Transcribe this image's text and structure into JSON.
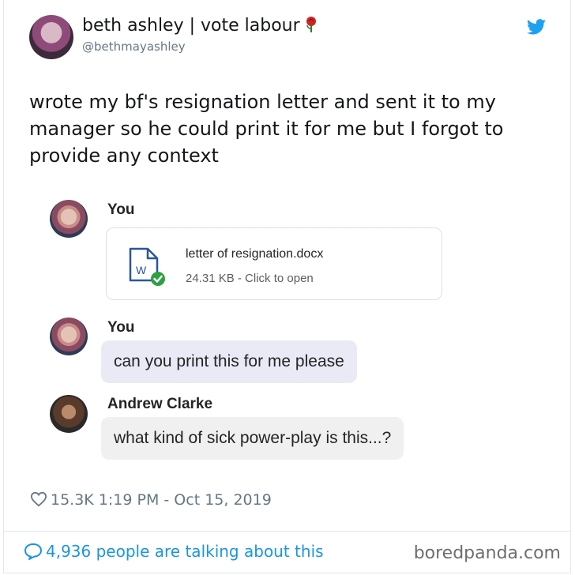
{
  "tweet": {
    "author_name": "beth ashley | vote labour",
    "author_handle": "@bethmayashley",
    "text": "wrote my bf's resignation letter and sent it to my manager so he could print it for me but I forgot to provide any context",
    "likes": "15.3K",
    "timestamp": "1:19 PM - Oct 15, 2019",
    "talking_about": "4,936 people are talking about this",
    "icons": [
      "rose-icon",
      "twitter-bird-icon",
      "heart-icon",
      "speech-bubble-icon"
    ],
    "accent_color": "#1b95e0"
  },
  "chat": {
    "messages": [
      {
        "sender": "You",
        "type": "file",
        "file_name": "letter of resignation.docx",
        "file_meta": "24.31 KB - Click to open",
        "file_icon_letter": "W"
      },
      {
        "sender": "You",
        "type": "text",
        "text": "can you print this for me please"
      },
      {
        "sender": "Andrew Clarke",
        "type": "text",
        "text": "what kind of sick power-play is this...?"
      }
    ]
  },
  "watermark": "boredpanda.com"
}
